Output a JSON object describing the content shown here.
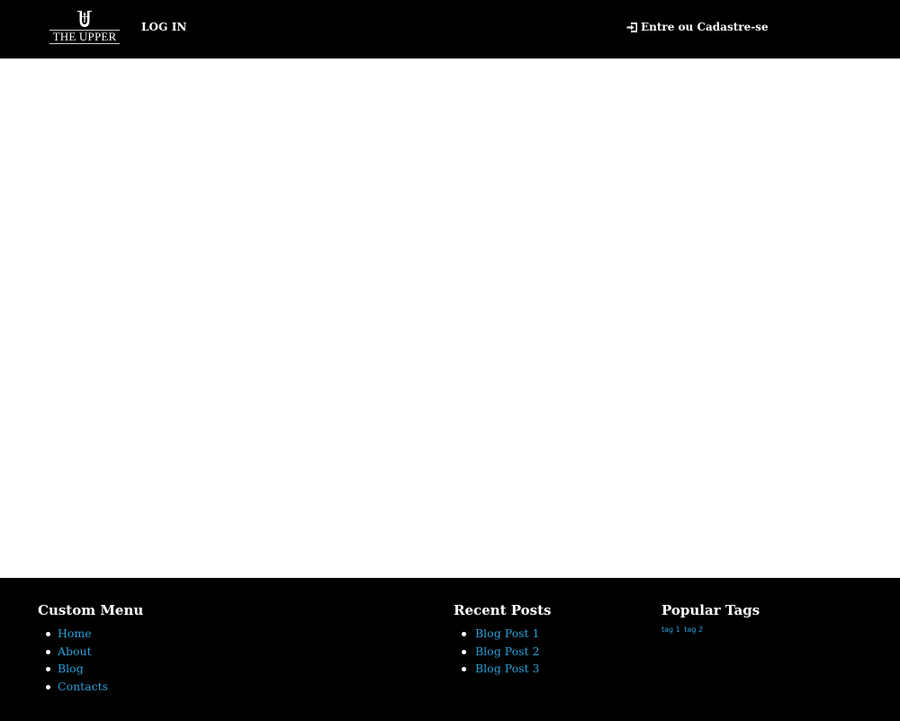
{
  "header": {
    "logo_text": "THE UPPER",
    "nav_login": "LOG IN",
    "account_link": "Entre ou Cadastre-se",
    "account_icon": "sign-in-icon"
  },
  "footer": {
    "custom_menu": {
      "title": "Custom Menu",
      "items": [
        {
          "label": "Home"
        },
        {
          "label": "About"
        },
        {
          "label": "Blog"
        },
        {
          "label": "Contacts"
        }
      ]
    },
    "recent_posts": {
      "title": "Recent Posts",
      "items": [
        {
          "label": "Blog Post 1"
        },
        {
          "label": "Blog Post 2"
        },
        {
          "label": "Blog Post 3"
        }
      ]
    },
    "popular_tags": {
      "title": "Popular Tags",
      "tags": [
        "tag 1",
        "tag 2"
      ]
    }
  },
  "colors": {
    "background": "#ffffff",
    "bar": "#000000",
    "text": "#ffffff",
    "link": "#2a9fd8"
  }
}
